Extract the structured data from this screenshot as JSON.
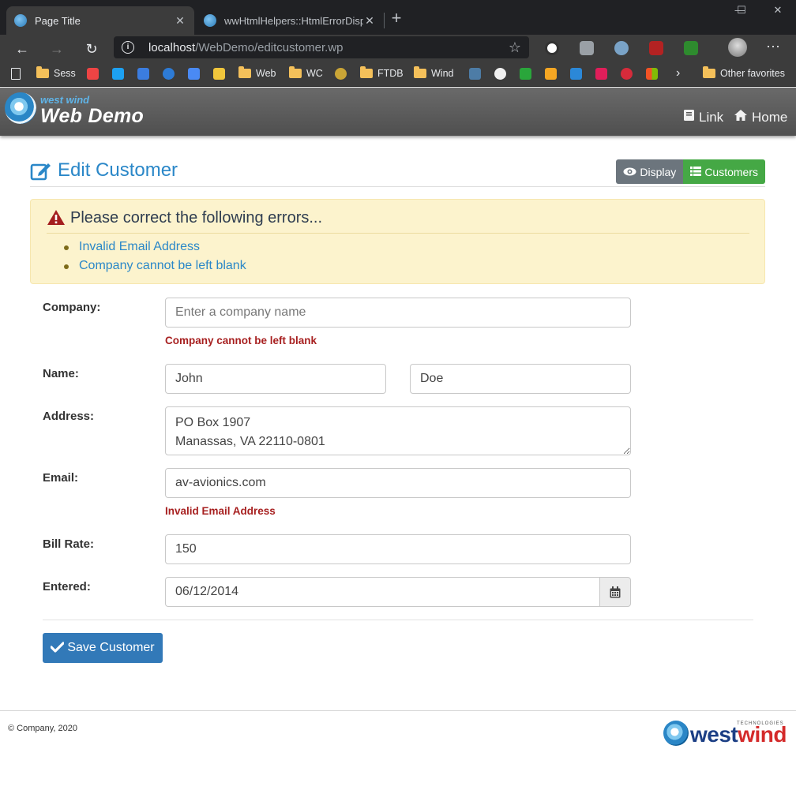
{
  "browser": {
    "tabs": [
      {
        "title": "Page Title",
        "active": true
      },
      {
        "title": "wwHtmlHelpers::HtmlErrorDisplay",
        "active": false
      }
    ],
    "url_host": "localhost",
    "url_path": "/WebDemo/editcustomer.wp",
    "bookmarks": [
      "Sess",
      "Web",
      "WC",
      "FTDB",
      "Wind",
      "Other favorites"
    ]
  },
  "navbar": {
    "brand_small": "west wind",
    "brand_big": "Web Demo",
    "links": [
      "Link",
      "Home"
    ]
  },
  "page": {
    "title": "Edit Customer",
    "display_button": "Display",
    "customers_button": "Customers"
  },
  "errors": {
    "title": "Please correct the following errors...",
    "items": [
      "Invalid Email Address",
      "Company cannot be left blank"
    ]
  },
  "form": {
    "company_label": "Company:",
    "company_placeholder": "Enter a company name",
    "company_value": "",
    "company_error": "Company cannot be left blank",
    "name_label": "Name:",
    "first_name": "John",
    "last_name": "Doe",
    "address_label": "Address:",
    "address": "PO Box 1907\nManassas, VA 22110-0801",
    "email_label": "Email:",
    "email": "av-avionics.com",
    "email_error": "Invalid Email Address",
    "billrate_label": "Bill Rate:",
    "billrate": "150",
    "entered_label": "Entered:",
    "entered": "06/12/2014",
    "save_button": "Save Customer"
  },
  "footer": {
    "copyright": "© Company, 2020",
    "logo_west": "west",
    "logo_wind": "wind",
    "logo_tech": "TECHNOLOGIES"
  }
}
